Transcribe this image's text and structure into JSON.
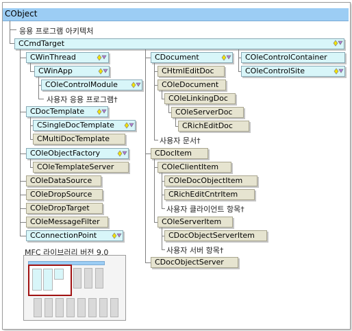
{
  "root": "CObject",
  "root_note": "응용 프로그램 아키텍처",
  "cmdtarget": "CCmdTarget",
  "left_column": {
    "cwinthread": "CWinThread",
    "cwinapp": "CWinApp",
    "colecontrolmodule": "COleControlModule",
    "user_apps": "사용자 응용 프로그램†",
    "cdoctemplate": "CDocTemplate",
    "csingledoctemplate": "CSingleDocTemplate",
    "cmultidoctemplate": "CMultiDocTemplate",
    "coleobjectfactory": "COleObjectFactory",
    "coletemplateserver": "COleTemplateServer",
    "coledatasource": "COleDataSource",
    "coledropsource": "COleDropSource",
    "coledroptarget": "COleDropTarget",
    "colemessagefilter": "COleMessageFilter",
    "cconnectionpoint": "CConnectionPoint"
  },
  "middle_column": {
    "cdocument": "CDocument",
    "chtmleditdoc": "CHtmlEditDoc",
    "coledocument": "COleDocument",
    "colelinkingdoc": "COleLinkingDoc",
    "coleserverdoc": "COleServerDoc",
    "cricheditdoc": "CRichEditDoc",
    "user_docs": "사용자 문서†",
    "cdocitem": "CDocItem",
    "coleclientitem": "COleClientItem",
    "coledocobjectitem": "COleDocObjectItem",
    "cricheditcntritem": "CRichEditCntrItem",
    "user_client_items": "사용자 클라이언트 항목†",
    "coleserveritem": "COleServerItem",
    "cdocobjectserveritem": "CDocObjectServerItem",
    "user_server_items": "사용자 서버 항목†",
    "cdocobjectserver": "CDocObjectServer"
  },
  "right_column": {
    "colecontrolcontainer": "COleControlContainer",
    "colecontrolsite": "COleControlSite"
  },
  "minimap_title": "MFC 라이브러리 버전 9.0",
  "colors": {
    "class_cyan": "#d8f6f9",
    "class_beige": "#e6e4d0",
    "header_blue": "#9ccdf4",
    "highlight_red": "#a01010"
  },
  "icons": [
    "yellow-diamond-icon",
    "diamond-chevron-icon"
  ]
}
